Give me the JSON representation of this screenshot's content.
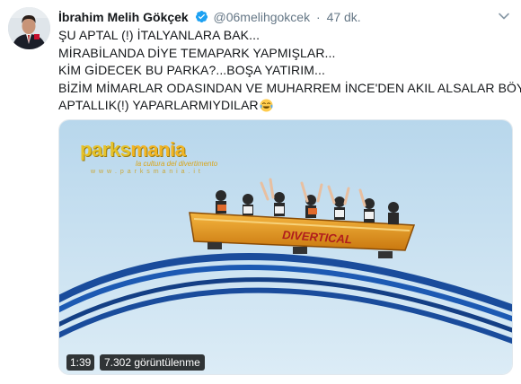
{
  "tweet": {
    "author": {
      "display_name": "İbrahim Melih Gökçek",
      "handle": "@06melihgokcek",
      "verified": true,
      "time": "47 dk."
    },
    "separator": "·",
    "text_lines": [
      "ŞU APTAL (!) İTALYANLARA BAK...",
      "MİRABİLANDA DİYE TEMAPARK YAPMIŞLAR...",
      "KİM GİDECEK BU PARKA?...BOŞA YATIRIM...",
      "BİZİM MİMARLAR ODASINDAN VE MUHARREM İNCE'DEN AKIL ALSALAR BÖYLE",
      "APTALLIK(!) YAPARLARMIYDILAR"
    ],
    "emoji": "face-with-tears-of-joy",
    "media": {
      "logo": {
        "brand_part1": "parks",
        "brand_part2": "mania",
        "tagline": "la cultura del divertimento",
        "url": "w w w . p a r k s m a n i a . i t"
      },
      "coaster_text": "DIVERTICAL",
      "duration": "1:39",
      "views": "7.302 görüntülenme"
    }
  },
  "icons": {
    "verified": "verified-badge-icon",
    "menu": "chevron-down-icon"
  },
  "colors": {
    "name": "#14171a",
    "secondary": "#657786",
    "verified": "#1da1f2",
    "sky": "#c8e0f0",
    "track": "#1a4fa0",
    "coaster": "#f0a21a"
  }
}
